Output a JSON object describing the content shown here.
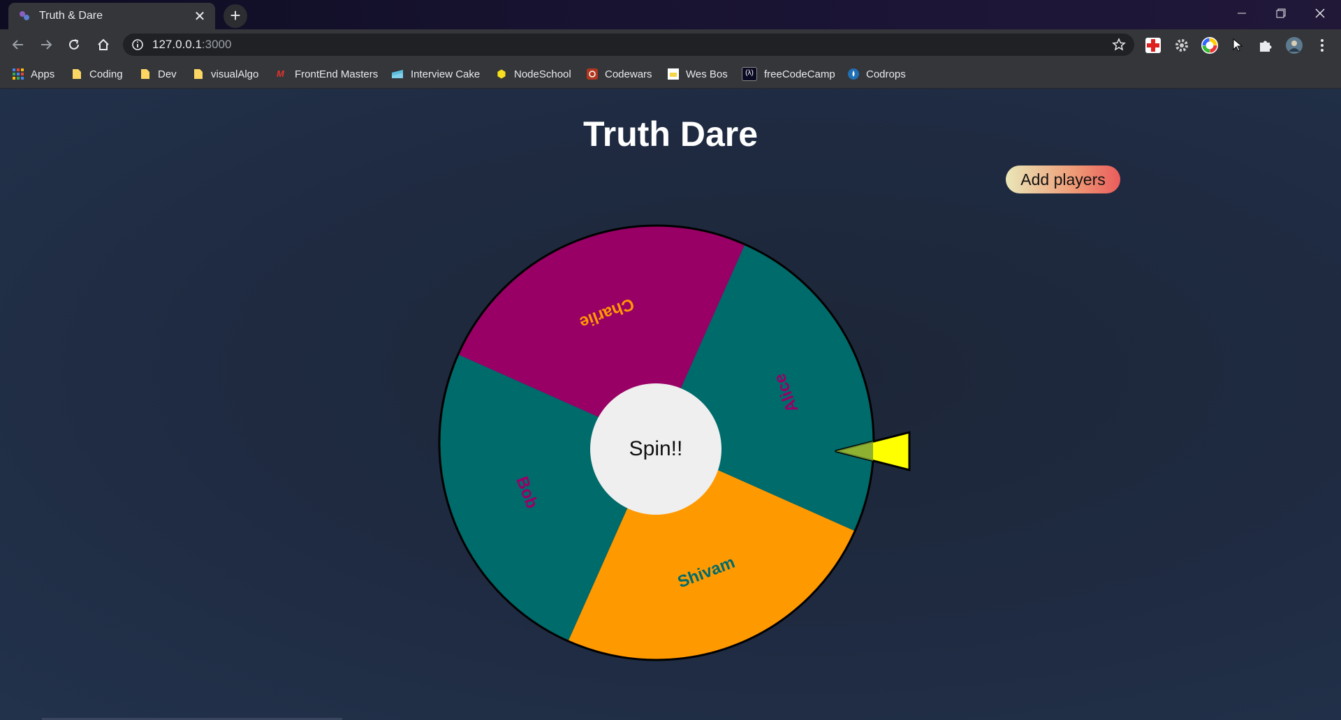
{
  "browser": {
    "tab_title": "Truth & Dare",
    "url_host": "127.0.0.1",
    "url_port": ":3000",
    "bookmarks": [
      {
        "label": "Apps",
        "icon": "apps-grid-icon"
      },
      {
        "label": "Coding",
        "icon": "folder-icon"
      },
      {
        "label": "Dev",
        "icon": "folder-icon"
      },
      {
        "label": "visualAlgo",
        "icon": "folder-icon"
      },
      {
        "label": "FrontEnd Masters",
        "icon": "frontend-masters-icon"
      },
      {
        "label": "Interview Cake",
        "icon": "interview-cake-icon"
      },
      {
        "label": "NodeSchool",
        "icon": "nodeschool-icon"
      },
      {
        "label": "Codewars",
        "icon": "codewars-icon"
      },
      {
        "label": "Wes Bos",
        "icon": "wesbos-icon"
      },
      {
        "label": "freeCodeCamp",
        "icon": "freecodecamp-icon"
      },
      {
        "label": "Codrops",
        "icon": "codrops-icon"
      }
    ]
  },
  "page": {
    "title": "Truth Dare",
    "add_players_label": "Add players",
    "spin_label": "Spin!!"
  },
  "wheel": {
    "segments": [
      {
        "name": "Alice",
        "color": "#006b6b",
        "text_color": "#990066"
      },
      {
        "name": "Shivam",
        "color": "#ff9900",
        "text_color": "#006b6b"
      },
      {
        "name": "Bob",
        "color": "#006b6b",
        "text_color": "#990066"
      },
      {
        "name": "Charlie",
        "color": "#990066",
        "text_color": "#ff9900"
      }
    ],
    "pointer_color": "#ffff00"
  }
}
